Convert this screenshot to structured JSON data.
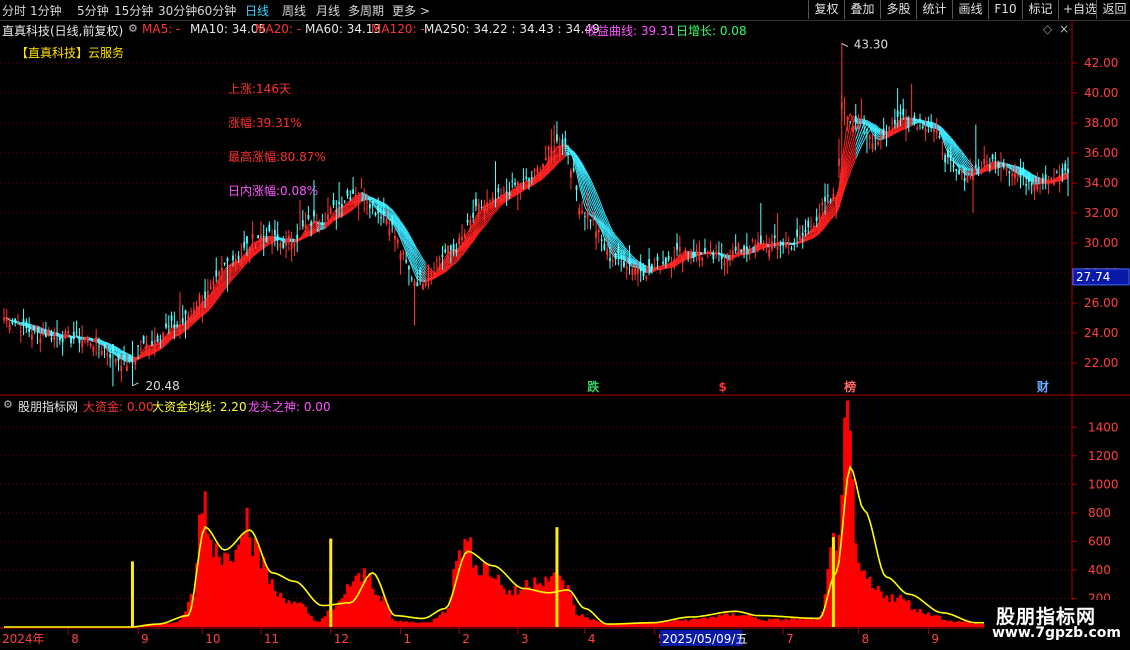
{
  "toolbar": {
    "periods": [
      "分时",
      "1分钟",
      "5分钟",
      "15分钟",
      "30分钟",
      "60分钟",
      "日线",
      "周线",
      "月线",
      "多周期",
      "更多 >"
    ],
    "active_index": 6,
    "right_buttons": [
      "复权",
      "叠加",
      "多股",
      "统计",
      "画线",
      "F10",
      "标记",
      "+自选",
      "返回"
    ]
  },
  "title": {
    "stock": "直真科技(日线,前复权)",
    "ma5": "MA5: -",
    "ma10": "MA10: 34.05",
    "ma20": "MA20: -",
    "ma60": "MA60: 34.13",
    "ma120": "MA120: -",
    "ma250": "MA250: 34.22 : 34.43 : 34.49",
    "income": "收益曲线: 39.31",
    "daily": "日增长: 0.08"
  },
  "notes": {
    "concept": "【直真科技】云服务",
    "rise_days": "上涨:146天",
    "rise_pct": "涨幅:39.31%",
    "max_rise": "最高涨幅:80.87%",
    "intraday": "日内涨幅:0.08%"
  },
  "markers": [
    {
      "label": "跌",
      "x_index": 211,
      "color": "#33cc66"
    },
    {
      "label": "$",
      "x_index": 258,
      "color": "#ff3333"
    },
    {
      "label": "榜",
      "x_index": 303,
      "color": "#ff6666"
    },
    {
      "label": "财",
      "x_index": 372,
      "color": "#66aaff"
    }
  ],
  "price_labels": {
    "high": "43.30",
    "low": "20.48",
    "current": "27.74"
  },
  "panel2": {
    "name": "股朋指标网",
    "big_money": "大资金: 0.00",
    "big_money_avg": "大资金均线: 2.20",
    "dragon": "龙头之神: 0.00"
  },
  "date_axis": {
    "year_label": "2024年",
    "months": [
      {
        "label": "8",
        "x_index": 23
      },
      {
        "label": "9",
        "x_index": 48
      },
      {
        "label": "10",
        "x_index": 71
      },
      {
        "label": "11",
        "x_index": 92
      },
      {
        "label": "12",
        "x_index": 117
      },
      {
        "label": "1",
        "x_index": 142
      },
      {
        "label": "2",
        "x_index": 163
      },
      {
        "label": "3",
        "x_index": 184
      },
      {
        "label": "4",
        "x_index": 208
      },
      {
        "label": "5",
        "x_index": 233
      },
      {
        "label": "7",
        "x_index": 279
      },
      {
        "label": "8",
        "x_index": 306
      },
      {
        "label": "9",
        "x_index": 331
      }
    ],
    "highlight_date": "2025/05/09/五",
    "highlight_index": 240
  },
  "watermark": {
    "line1": "股朋指标网",
    "line2": "www.7gpzb.com"
  },
  "colors": {
    "up": "#ff3333",
    "down": "#54ffff",
    "ma_up": "#ff2020",
    "ma_down": "#3ee8ff",
    "volume": "#ff0000",
    "avg_line": "#ffff00",
    "spike": "#ffee00",
    "grid": "#7a0000",
    "axis": "#b00000",
    "tick": "#ff4040"
  },
  "chart_data": [
    {
      "type": "candlestick",
      "title": "",
      "yticks": [
        22.0,
        24.0,
        26.0,
        28.0,
        30.0,
        32.0,
        34.0,
        36.0,
        38.0,
        40.0,
        42.0
      ],
      "ylim": [
        20.0,
        43.6
      ],
      "n_bars": 382,
      "ma_ribbon": true,
      "anchors": [
        [
          0,
          25.0
        ],
        [
          12,
          24.0
        ],
        [
          28,
          23.6
        ],
        [
          46,
          22.0
        ],
        [
          48,
          23.0
        ],
        [
          62,
          24.5
        ],
        [
          72,
          26.5
        ],
        [
          82,
          29.0
        ],
        [
          92,
          30.5
        ],
        [
          100,
          30.0
        ],
        [
          112,
          31.5
        ],
        [
          127,
          33.5
        ],
        [
          135,
          32.0
        ],
        [
          148,
          27.5
        ],
        [
          160,
          29.5
        ],
        [
          172,
          32.5
        ],
        [
          186,
          34.0
        ],
        [
          200,
          36.8
        ],
        [
          208,
          32.0
        ],
        [
          218,
          29.0
        ],
        [
          230,
          28.2
        ],
        [
          244,
          29.5
        ],
        [
          256,
          29.0
        ],
        [
          268,
          29.8
        ],
        [
          282,
          30.0
        ],
        [
          298,
          33.0
        ],
        [
          300,
          39.0
        ],
        [
          304,
          38.2
        ],
        [
          312,
          37.0
        ],
        [
          322,
          38.5
        ],
        [
          330,
          38.0
        ],
        [
          342,
          34.5
        ],
        [
          356,
          35.5
        ],
        [
          366,
          34.2
        ],
        [
          380,
          34.5
        ]
      ],
      "high_point": {
        "index": 300,
        "value": 43.3
      },
      "low_point": {
        "index": 46,
        "value": 20.48
      },
      "current": 27.74
    },
    {
      "type": "bar+line",
      "title": "",
      "yticks": [
        200,
        400,
        600,
        800,
        1000,
        1200,
        1400
      ],
      "ylim": [
        0,
        1500
      ],
      "series": [
        {
          "name": "大资金",
          "anchors": [
            [
              0,
              0
            ],
            [
              45,
              0
            ],
            [
              52,
              20
            ],
            [
              62,
              30
            ],
            [
              68,
              220
            ],
            [
              71,
              960
            ],
            [
              74,
              600
            ],
            [
              80,
              480
            ],
            [
              86,
              780
            ],
            [
              92,
              460
            ],
            [
              98,
              230
            ],
            [
              106,
              150
            ],
            [
              112,
              40
            ],
            [
              118,
              120
            ],
            [
              124,
              300
            ],
            [
              130,
              360
            ],
            [
              135,
              220
            ],
            [
              140,
              40
            ],
            [
              152,
              30
            ],
            [
              158,
              120
            ],
            [
              164,
              580
            ],
            [
              172,
              420
            ],
            [
              182,
              240
            ],
            [
              192,
              350
            ],
            [
              200,
              330
            ],
            [
              206,
              80
            ],
            [
              216,
              20
            ],
            [
              232,
              30
            ],
            [
              245,
              50
            ],
            [
              258,
              80
            ],
            [
              264,
              90
            ],
            [
              272,
              50
            ],
            [
              292,
              60
            ],
            [
              298,
              640
            ],
            [
              302,
              1340
            ],
            [
              306,
              400
            ],
            [
              312,
              260
            ],
            [
              320,
              200
            ],
            [
              330,
              100
            ],
            [
              340,
              40
            ],
            [
              352,
              20
            ],
            [
              381,
              20
            ]
          ]
        },
        {
          "name": "大资金均线",
          "anchors": [
            [
              0,
              0
            ],
            [
              45,
              0
            ],
            [
              55,
              20
            ],
            [
              66,
              80
            ],
            [
              72,
              700
            ],
            [
              79,
              540
            ],
            [
              88,
              680
            ],
            [
              96,
              380
            ],
            [
              104,
              320
            ],
            [
              114,
              150
            ],
            [
              124,
              170
            ],
            [
              132,
              380
            ],
            [
              140,
              80
            ],
            [
              150,
              60
            ],
            [
              158,
              130
            ],
            [
              166,
              530
            ],
            [
              175,
              430
            ],
            [
              186,
              270
            ],
            [
              195,
              240
            ],
            [
              202,
              260
            ],
            [
              208,
              130
            ],
            [
              216,
              20
            ],
            [
              232,
              30
            ],
            [
              246,
              70
            ],
            [
              262,
              110
            ],
            [
              270,
              80
            ],
            [
              292,
              60
            ],
            [
              298,
              380
            ],
            [
              303,
              1120
            ],
            [
              308,
              820
            ],
            [
              316,
              350
            ],
            [
              324,
              230
            ],
            [
              336,
              100
            ],
            [
              348,
              30
            ],
            [
              381,
              20
            ]
          ]
        },
        {
          "name": "龙头之神",
          "spikes": [
            [
              46,
              460
            ],
            [
              117,
              620
            ],
            [
              198,
              700
            ],
            [
              297,
              630
            ]
          ]
        }
      ]
    }
  ]
}
